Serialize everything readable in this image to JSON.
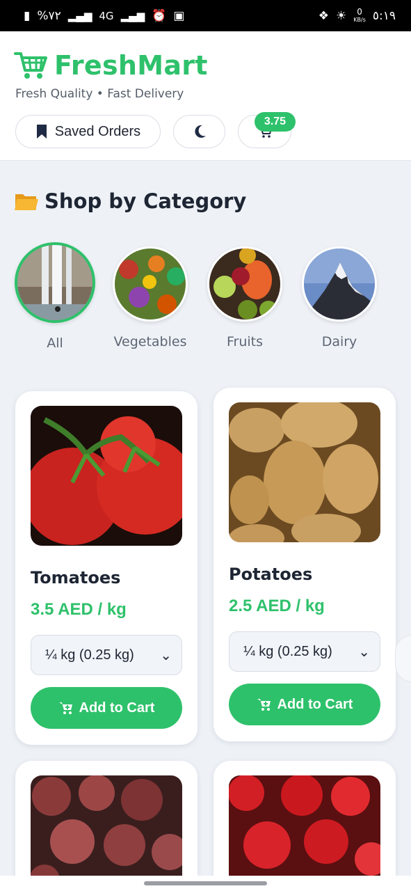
{
  "status_bar": {
    "left_text": "%٧٢",
    "signal_label": "4G",
    "speed_value": "0",
    "speed_unit": "KB/s",
    "time": "٥:١٩"
  },
  "header": {
    "brand_name": "FreshMart",
    "tagline": "Fresh Quality • Fast Delivery",
    "saved_orders_label": "Saved Orders",
    "cart_total": "3.75"
  },
  "section": {
    "title": "Shop by Category",
    "icon": "folder-icon"
  },
  "categories": [
    {
      "label": "All",
      "active": true
    },
    {
      "label": "Vegetables",
      "active": false
    },
    {
      "label": "Fruits",
      "active": false
    },
    {
      "label": "Dairy",
      "active": false
    }
  ],
  "products": [
    {
      "name": "Tomatoes",
      "price": "3.5 AED / kg",
      "quantity": "¼ kg (0.25 kg)",
      "add_label": "Add to Cart"
    },
    {
      "name": "Potatoes",
      "price": "2.5 AED / kg",
      "quantity": "¼ kg (0.25 kg)",
      "add_label": "Add to Cart"
    }
  ],
  "colors": {
    "accent": "#2ec16b",
    "text_dark": "#1e2533",
    "background": "#eef2f7"
  }
}
